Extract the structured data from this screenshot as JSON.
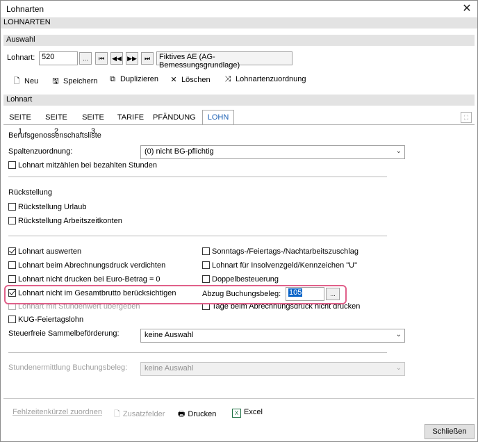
{
  "window": {
    "title": "Lohnarten",
    "close_icon": "close-icon"
  },
  "header": {
    "label": "LOHNARTEN"
  },
  "auswahl": {
    "section_label": "Auswahl",
    "lohnart_label": "Lohnart:",
    "lohnart_value": "520",
    "browse_label": "...",
    "nav_first": "⏮",
    "nav_prev": "◀◀",
    "nav_next": "▶▶",
    "nav_last": "⏭",
    "description": "Fiktives AE (AG-Bemessungsgrundlage)"
  },
  "toolbar": {
    "new_label": "Neu",
    "save_label": "Speichern",
    "duplicate_label": "Duplizieren",
    "delete_label": "Löschen",
    "assign_label": "Lohnartenzuordnung"
  },
  "lohnart_section": {
    "label": "Lohnart"
  },
  "tabs": [
    {
      "label": "SEITE 1"
    },
    {
      "label": "SEITE 2"
    },
    {
      "label": "SEITE 3"
    },
    {
      "label": "TARIFE"
    },
    {
      "label": "PFÄNDUNG"
    },
    {
      "label": "LOHN"
    }
  ],
  "bg": {
    "title": "Berufsgenossenschaftsliste",
    "spalten_label": "Spaltenzuordnung:",
    "spalten_value": "(0) nicht BG-pflichtig",
    "mitzaehlen_label": "Lohnart mitzählen bei bezahlten Stunden"
  },
  "rueck": {
    "title": "Rückstellung",
    "urlaub_label": "Rückstellung Urlaub",
    "arbeitszeit_label": "Rückstellung Arbeitszeitkonten"
  },
  "options": {
    "auswerten_label": "Lohnart auswerten",
    "verdichten_label": "Lohnart beim Abrechnungsdruck verdichten",
    "nicht_drucken_label": "Lohnart nicht drucken bei Euro-Betrag = 0",
    "gesamtbrutto_label": "Lohnart nicht im Gesamtbrutto berücksichtigen",
    "stundenwert_label": "Lohnart mit Stundenwert übergeben",
    "kug_label": "KUG-Feiertagslohn",
    "sonntag_label": "Sonntags-/Feiertags-/Nachtarbeitszuschlag",
    "insolvenz_label": "Lohnart für Insolvenzgeld/Kennzeichen \"U\"",
    "doppel_label": "Doppelbesteuerung",
    "abzug_label": "Abzug Buchungsbeleg:",
    "abzug_value": "105",
    "abzug_browse": "...",
    "tage_label": "Tage beim Abrechnungsdruck nicht drucken",
    "steuerfrei_label": "Steuerfreie Sammelbeförderung:",
    "steuerfrei_value": "keine Auswahl",
    "stundenermittlung_label": "Stundenermittlung Buchungsbeleg:",
    "stundenermittlung_value": "keine Auswahl"
  },
  "footer": {
    "fehlzeiten_label": "Fehlzeitenkürzel zuordnen",
    "zusatz_label": "Zusatzfelder",
    "drucken_label": "Drucken",
    "excel_label": "Excel",
    "close_label": "Schließen"
  },
  "colors": {
    "accent": "#1a5fb4",
    "highlight": "#e0608a",
    "section_bg": "#e3e3e3"
  }
}
